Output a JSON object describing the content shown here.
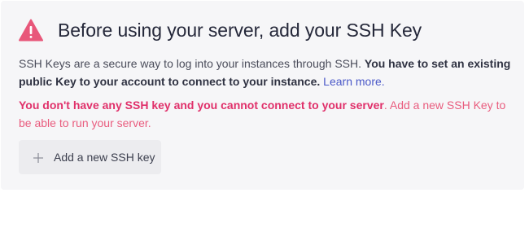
{
  "header": {
    "title": "Before using your server, add your SSH Key",
    "icon": "warning-triangle-icon",
    "icon_color": "#e8577a"
  },
  "description": {
    "text": "SSH Keys are a secure way to log into your instances through SSH. ",
    "strong": "You have to set an existing public Key to your account to connect to your instance.",
    "link": "Learn more."
  },
  "alert": {
    "strong": "You don't have any SSH key and you cannot connect to your server",
    "text": ". Add a new SSH Key to be able to run your server.",
    "color": "#e0306a"
  },
  "add_button": {
    "icon": "plus-icon",
    "label": "Add a new SSH key"
  }
}
